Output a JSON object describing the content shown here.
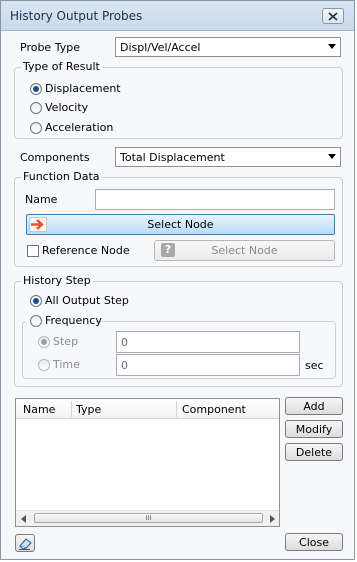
{
  "window": {
    "title": "History Output Probes"
  },
  "probe_type": {
    "label": "Probe Type",
    "value": "Displ/Vel/Accel"
  },
  "type_of_result": {
    "title": "Type of Result",
    "options": [
      {
        "label": "Displacement",
        "selected": true
      },
      {
        "label": "Velocity",
        "selected": false
      },
      {
        "label": "Acceleration",
        "selected": false
      }
    ]
  },
  "components": {
    "label": "Components",
    "value": "Total Displacement"
  },
  "function_data": {
    "title": "Function Data",
    "name_label": "Name",
    "name_value": "",
    "select_node_label": "Select Node",
    "reference_node_label": "Reference Node",
    "reference_checked": false,
    "ref_select_node_label": "Select Node"
  },
  "history_step": {
    "title": "History Step",
    "all_output_label": "All Output Step",
    "frequency_label": "Frequency",
    "step_label": "Step",
    "step_value": "0",
    "time_label": "Time",
    "time_value": "0",
    "time_unit": "sec"
  },
  "table": {
    "columns": [
      "Name",
      "Type",
      "Component"
    ],
    "rows": [],
    "scroll_thumb_glyph": "III"
  },
  "buttons": {
    "add": "Add",
    "modify": "Modify",
    "delete": "Delete",
    "close": "Close"
  },
  "colors": {
    "accent": "#1a4f8f",
    "select_node_bg": "#b7dcf5",
    "arrow_icon": "#e8502a"
  }
}
